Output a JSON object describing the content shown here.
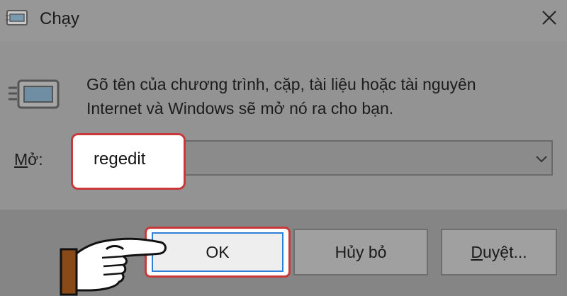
{
  "window": {
    "title": "Chạy"
  },
  "icons": {
    "app": "run-dialog-icon",
    "close": "close-icon",
    "run_large": "run-program-icon",
    "dropdown": "chevron-down-icon",
    "hand": "pointing-hand-icon"
  },
  "body": {
    "description_line1": "Gõ tên của chương trình, cặp, tài liệu hoặc tài nguyên",
    "description_line2": "Internet và Windows sẽ mở nó ra cho bạn."
  },
  "open_field": {
    "label_prefix": "M",
    "label_rest": "ở:",
    "value": "regedit"
  },
  "buttons": {
    "ok": "OK",
    "cancel": "Hủy bỏ",
    "browse_prefix": "D",
    "browse_rest": "uyệt..."
  },
  "colors": {
    "highlight": "#c83a3a",
    "focus_ring": "#2f7fd8"
  }
}
